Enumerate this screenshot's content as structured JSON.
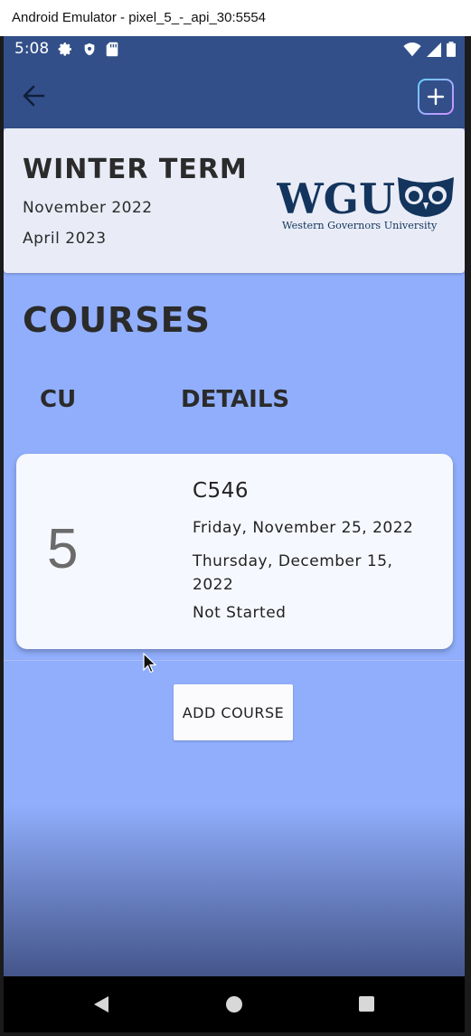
{
  "window": {
    "title": "Android Emulator - pixel_5_-_api_30:5554"
  },
  "status_bar": {
    "time": "5:08",
    "icons_left": [
      "gear-icon",
      "shield-icon",
      "sd-card-icon"
    ],
    "icons_right": [
      "wifi-icon",
      "signal-icon",
      "battery-icon"
    ]
  },
  "app_bar": {
    "back_icon": "arrow-left-icon",
    "add_icon": "plus-icon",
    "color": "#324f89"
  },
  "term": {
    "title": "WINTER TERM",
    "start": "November 2022",
    "end": "April 2023",
    "logo": {
      "wordmark": "WGU",
      "subtitle": "Western Governors University"
    }
  },
  "courses": {
    "heading": "COURSES",
    "columns": {
      "cu": "CU",
      "details": "DETAILS"
    },
    "items": [
      {
        "cu": "5",
        "code": "C546",
        "start": "Friday, November 25, 2022",
        "end": "Thursday, December 15, 2022",
        "status": "Not Started"
      }
    ]
  },
  "actions": {
    "add_course_label": "ADD COURSE"
  },
  "colors": {
    "background": "#90aefc",
    "card": "#f6f8ff",
    "header": "#e9ecf7",
    "brand": "#13355d"
  }
}
